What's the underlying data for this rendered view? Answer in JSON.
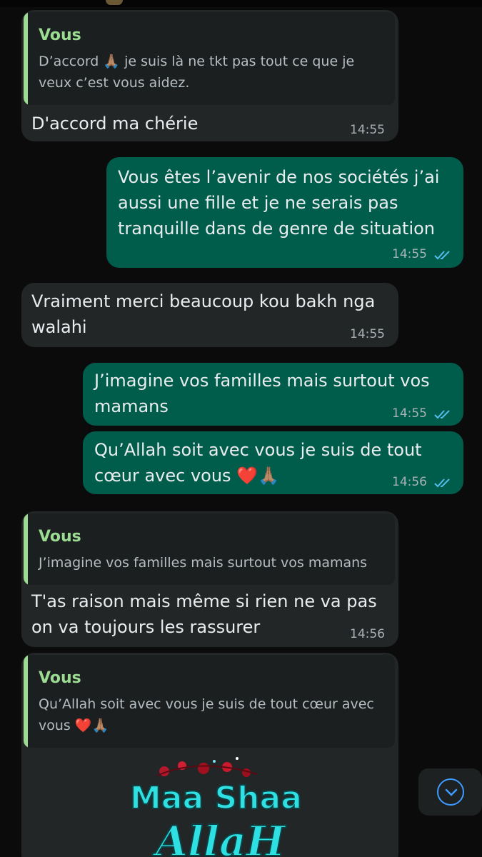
{
  "messages": {
    "m1": {
      "quote_author": "Vous",
      "quote_line1": "D’accord 🙏🏽 je suis là ne tkt pas tout ce que je",
      "quote_line2": "veux c’est vous aidez.",
      "text": "D'accord ma chérie",
      "time": "14:55"
    },
    "m2": {
      "line1": "Vous êtes l’avenir de nos sociétés j’ai",
      "line2": "aussi une fille et je ne serais pas",
      "line3": "tranquille dans de genre de situation",
      "time": "14:55",
      "status": "read"
    },
    "m3": {
      "line1": "Vraiment merci beaucoup kou bakh nga",
      "line2": "walahi",
      "time": "14:55"
    },
    "m4": {
      "line1": "J’imagine vos familles mais surtout vos",
      "line2": "mamans",
      "time": "14:55",
      "status": "read"
    },
    "m5": {
      "line1": "Qu’Allah soit avec vous je suis de tout",
      "line2": "cœur avec vous ❤️🙏🏽",
      "time": "14:56",
      "status": "read"
    },
    "m6": {
      "quote_author": "Vous",
      "quote_line1": "J’imagine vos familles mais surtout vos mamans",
      "line1": "T'as raison mais même si rien ne va pas",
      "line2": "on va toujours les rassurer",
      "time": "14:56"
    },
    "m7": {
      "quote_author": "Vous",
      "quote_line1": "Qu’Allah soit avec vous je suis de tout cœur avec",
      "quote_line2": "vous ❤️🙏🏽",
      "sticker_line1": "Maa Shaa",
      "sticker_line2": "AllaH"
    }
  },
  "colors": {
    "incoming": "#232626",
    "outgoing": "#005c4b",
    "quote_accent": "#9bdc92",
    "read_ticks": "#53bdeb",
    "background": "#0b0b0b"
  },
  "icons": {
    "read": "double-check-icon",
    "scroll": "chevron-down-icon"
  }
}
